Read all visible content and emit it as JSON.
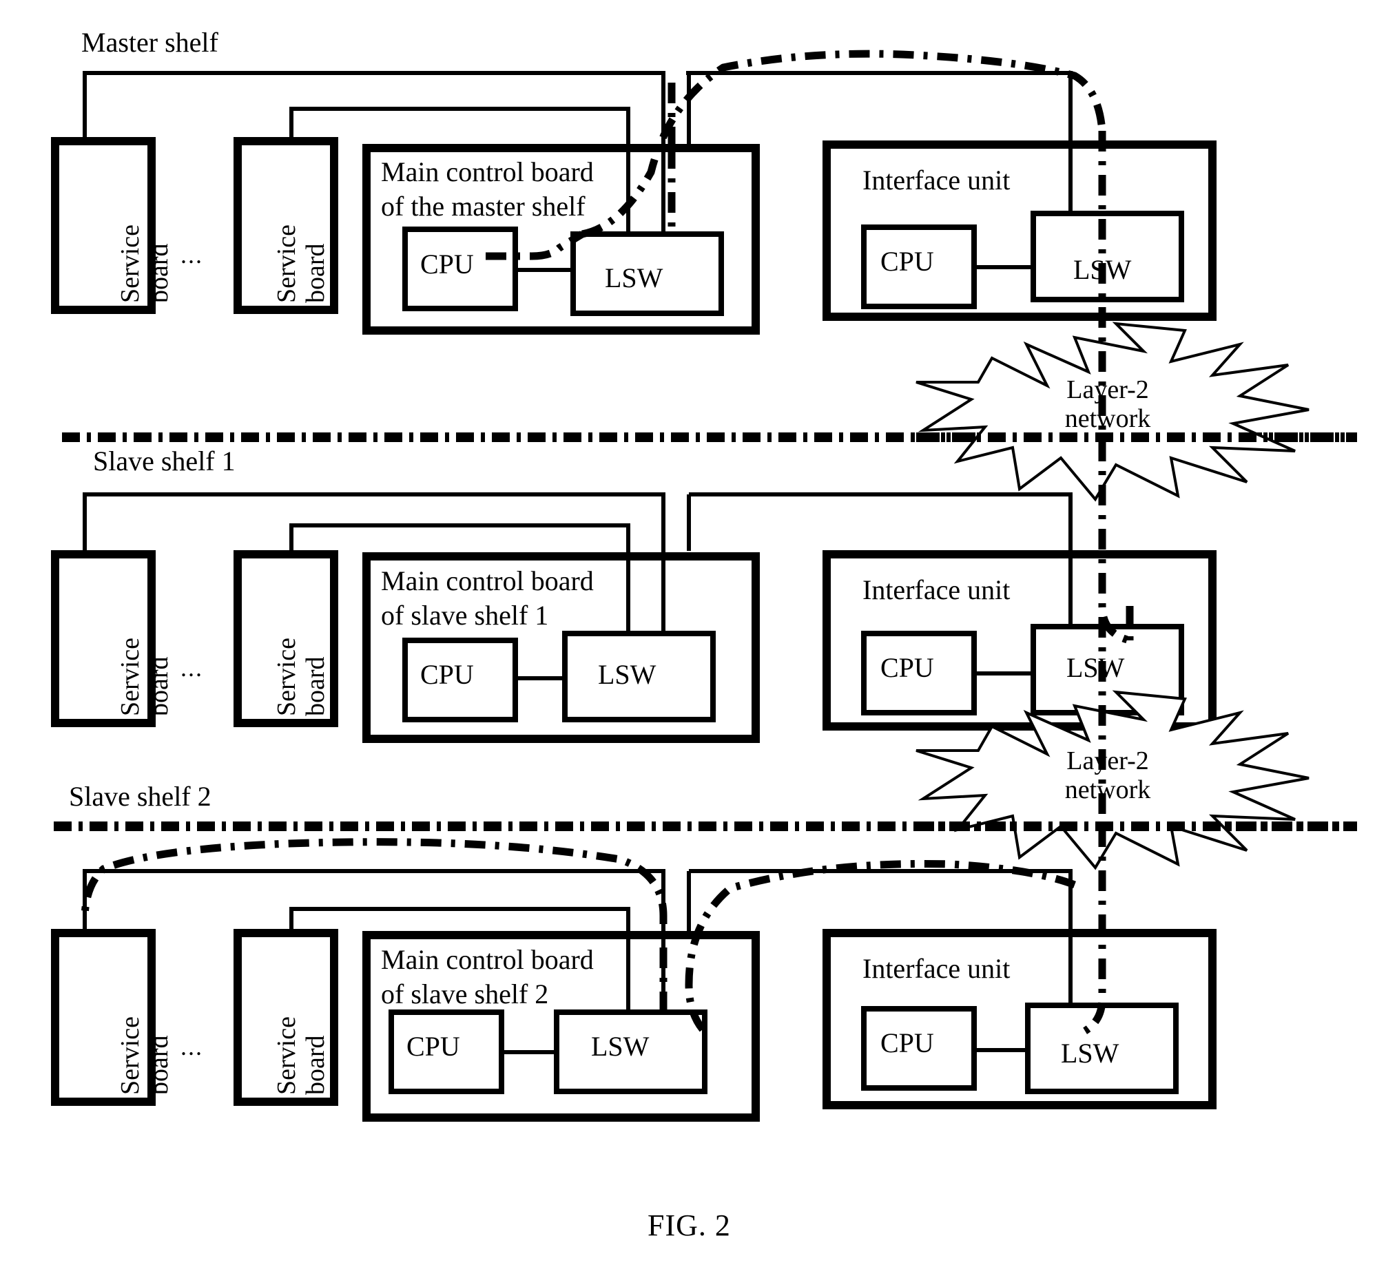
{
  "figure": {
    "caption": "FIG. 2",
    "background": "#ffffff",
    "stroke": "#000000"
  },
  "shelves": [
    {
      "id": "master",
      "title": "Master shelf",
      "service_boards": [
        {
          "label_line1": "Service",
          "label_line2": "board"
        },
        {
          "label_line1": "Service",
          "label_line2": "board"
        }
      ],
      "ellipsis": "...",
      "main_board": {
        "title_line1": "Main control board",
        "title_line2": "of the master shelf",
        "cpu": "CPU",
        "lsw": "LSW"
      },
      "interface_unit": {
        "title": "Interface unit",
        "cpu": "CPU",
        "lsw": "LSW"
      }
    },
    {
      "id": "slave1",
      "title": "Slave shelf 1",
      "service_boards": [
        {
          "label_line1": "Service",
          "label_line2": "board"
        },
        {
          "label_line1": "Service",
          "label_line2": "board"
        }
      ],
      "ellipsis": "...",
      "main_board": {
        "title_line1": "Main control board",
        "title_line2": "of slave shelf 1",
        "cpu": "CPU",
        "lsw": "LSW"
      },
      "interface_unit": {
        "title": "Interface unit",
        "cpu": "CPU",
        "lsw": "LSW"
      }
    },
    {
      "id": "slave2",
      "title": "Slave shelf 2",
      "service_boards": [
        {
          "label_line1": "Service",
          "label_line2": "board"
        },
        {
          "label_line1": "Service",
          "label_line2": "board"
        }
      ],
      "ellipsis": "...",
      "main_board": {
        "title_line1": "Main control board",
        "title_line2": "of slave shelf 2",
        "cpu": "CPU",
        "lsw": "LSW"
      },
      "interface_unit": {
        "title": "Interface unit",
        "cpu": "CPU",
        "lsw": "LSW"
      }
    }
  ],
  "networks": [
    {
      "id": "net-upper",
      "line1": "Layer-2",
      "line2": "network"
    },
    {
      "id": "net-lower",
      "line1": "Layer-2",
      "line2": "network"
    }
  ]
}
